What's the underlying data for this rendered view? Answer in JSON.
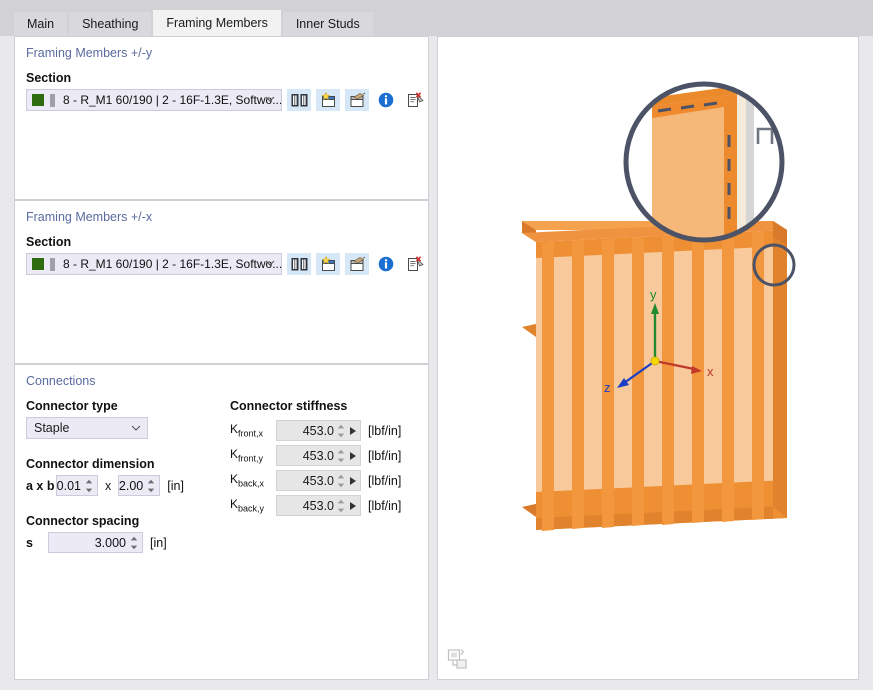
{
  "tabs": [
    {
      "label": "Main",
      "active": false
    },
    {
      "label": "Sheathing",
      "active": false
    },
    {
      "label": "Framing Members",
      "active": true
    },
    {
      "label": "Inner Studs",
      "active": false
    }
  ],
  "panel_y": {
    "title": "Framing Members +/-y",
    "section_label": "Section",
    "section_value": "8 - R_M1 60/190 | 2 - 16F-1.3E, Softwo...",
    "swatch_color": "#2f6b0f",
    "icons": [
      "library-icon",
      "new-section-icon",
      "edit-section-icon",
      "info-icon",
      "delete-section-icon"
    ]
  },
  "panel_x": {
    "title": "Framing Members +/-x",
    "section_label": "Section",
    "section_value": "8 - R_M1 60/190 | 2 - 16F-1.3E, Softwo...",
    "swatch_color": "#2f6b0f",
    "icons": [
      "library-icon",
      "new-section-icon",
      "edit-section-icon",
      "info-icon",
      "delete-section-icon"
    ]
  },
  "connections": {
    "title": "Connections",
    "connector_type_label": "Connector type",
    "connector_type_value": "Staple",
    "connector_dimension_label": "Connector dimension",
    "dimension_row_label": "a x b",
    "dimension_a": "0.01",
    "dimension_sep": "x",
    "dimension_b": "2.00",
    "dimension_unit": "[in]",
    "connector_spacing_label": "Connector spacing",
    "spacing_symbol": "s",
    "spacing_value": "3.000",
    "spacing_unit": "[in]",
    "stiffness_title": "Connector stiffness",
    "stiffness_rows": [
      {
        "sym": "K",
        "sub": "front,x",
        "value": "453.0",
        "unit": "[lbf/in]"
      },
      {
        "sym": "K",
        "sub": "front,y",
        "value": "453.0",
        "unit": "[lbf/in]"
      },
      {
        "sym": "K",
        "sub": "back,x",
        "value": "453.0",
        "unit": "[lbf/in]"
      },
      {
        "sym": "K",
        "sub": "back,y",
        "value": "453.0",
        "unit": "[lbf/in]"
      }
    ]
  },
  "viewport": {
    "axis": {
      "x": "x",
      "y": "y",
      "z": "z"
    },
    "axis_colors": {
      "x": "#c0392b",
      "y": "#1f8a2f",
      "z": "#1a3fc4",
      "origin": "#f5d600"
    },
    "model": {
      "name": "timber-wall-frame",
      "stud_count": 8,
      "frame_color": "#f08a2e",
      "panel_color": "#f7c99b"
    },
    "detail_callout": {
      "name": "magnifier-detail",
      "ring_color": "#4c5366",
      "staple_glyph": "Π"
    },
    "bottom_icon": "view-settings-icon"
  }
}
